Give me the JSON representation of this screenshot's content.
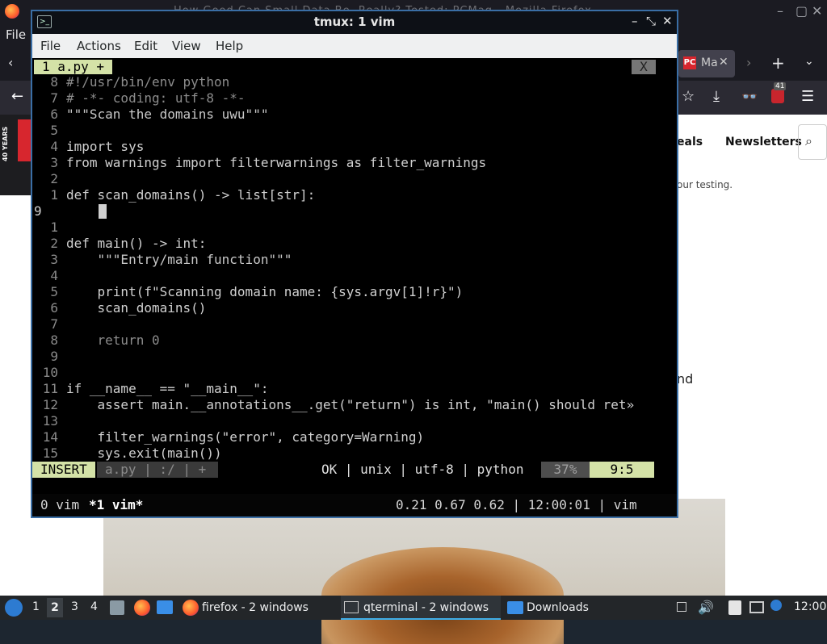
{
  "browser": {
    "title": "How Good Can Small Data Be, Really? Tested: PCMag - Mozilla Firefox",
    "menu_file": "File",
    "tab_label": "Ma",
    "tab_badge": "41",
    "nav_item_deals": "eals",
    "nav_item_newsletters": "Newsletters",
    "body_snippet": "our testing.",
    "body_snippet2": "nd",
    "side_badge": "40 YEARS"
  },
  "terminal": {
    "title": "tmux: 1 vim",
    "menu": [
      "File",
      "Actions",
      "Edit",
      "View",
      "Help"
    ]
  },
  "vim": {
    "tab_label": "1 a.py +",
    "tab_close": "X",
    "lines": [
      {
        "n": "8",
        "text": "#!/usr/bin/env python",
        "cls": "cm"
      },
      {
        "n": "7",
        "text": "# -*- coding: utf-8 -*-",
        "cls": "cm"
      },
      {
        "n": "6",
        "text": "\"\"\"Scan the domains uwu\"\"\"",
        "cls": "st"
      },
      {
        "n": "5",
        "text": "",
        "cls": ""
      },
      {
        "n": "4",
        "text": "import sys",
        "cls": "kw"
      },
      {
        "n": "3",
        "text": "from warnings import filterwarnings as filter_warnings",
        "cls": "kw"
      },
      {
        "n": "2",
        "text": "",
        "cls": ""
      },
      {
        "n": "1",
        "text": "def scan_domains() -> list[str]:",
        "cls": "kw"
      },
      {
        "n": "9",
        "text": "    ",
        "cls": "cur"
      },
      {
        "n": "1",
        "text": "",
        "cls": ""
      },
      {
        "n": "2",
        "text": "def main() -> int:",
        "cls": "kw"
      },
      {
        "n": "3",
        "text": "    \"\"\"Entry/main function\"\"\"",
        "cls": "st"
      },
      {
        "n": "4",
        "text": "",
        "cls": ""
      },
      {
        "n": "5",
        "text": "    print(f\"Scanning domain name: {sys.argv[1]!r}\")",
        "cls": "kw"
      },
      {
        "n": "6",
        "text": "    scan_domains()",
        "cls": "kw"
      },
      {
        "n": "7",
        "text": "",
        "cls": ""
      },
      {
        "n": "8",
        "text": "    return 0",
        "cls": "cm"
      },
      {
        "n": "9",
        "text": "",
        "cls": ""
      },
      {
        "n": "10",
        "text": "",
        "cls": ""
      },
      {
        "n": "11",
        "text": "if __name__ == \"__main__\":",
        "cls": "kw"
      },
      {
        "n": "12",
        "text": "    assert main.__annotations__.get(\"return\") is int, \"main() should ret»",
        "cls": "kw"
      },
      {
        "n": "13",
        "text": "",
        "cls": ""
      },
      {
        "n": "14",
        "text": "    filter_warnings(\"error\", category=Warning)",
        "cls": "kw"
      },
      {
        "n": "15",
        "text": "    sys.exit(main())",
        "cls": "kw"
      }
    ],
    "mode": "INSERT",
    "file": "a.py | :/ | +",
    "status_info": "OK | unix | utf-8 | python",
    "percent": "37%",
    "position": "9:5"
  },
  "tmux": {
    "windows": "0 vim",
    "active_window": "*1 vim*",
    "right": "0.21 0.67 0.62 | 12:00:01 | vim"
  },
  "taskbar": {
    "desktops": [
      "1",
      "2",
      "3",
      "4"
    ],
    "firefox_task": "firefox - 2 windows",
    "qterminal_task": "qterminal - 2 windows",
    "downloads_task": "Downloads",
    "clock": "12:00"
  }
}
